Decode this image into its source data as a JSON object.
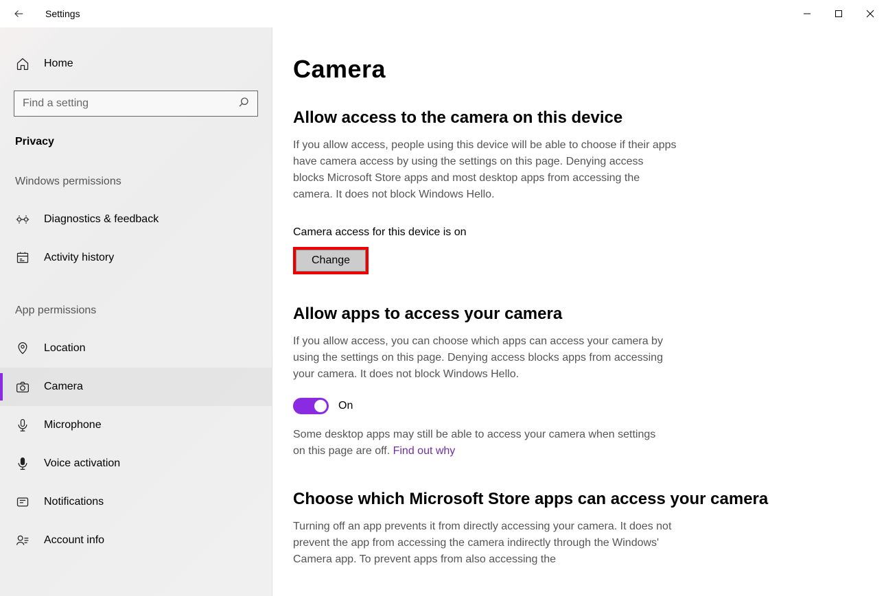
{
  "window": {
    "app_title": "Settings"
  },
  "sidebar": {
    "home_label": "Home",
    "search_placeholder": "Find a setting",
    "category_label": "Privacy",
    "groups": [
      {
        "label": "Windows permissions",
        "items": [
          {
            "id": "diagnostics",
            "label": "Diagnostics & feedback",
            "icon": "diagnostics-icon",
            "selected": false
          },
          {
            "id": "activity",
            "label": "Activity history",
            "icon": "history-icon",
            "selected": false
          }
        ]
      },
      {
        "label": "App permissions",
        "items": [
          {
            "id": "location",
            "label": "Location",
            "icon": "location-icon",
            "selected": false
          },
          {
            "id": "camera",
            "label": "Camera",
            "icon": "camera-icon",
            "selected": true
          },
          {
            "id": "microphone",
            "label": "Microphone",
            "icon": "microphone-icon",
            "selected": false
          },
          {
            "id": "voice",
            "label": "Voice activation",
            "icon": "voice-icon",
            "selected": false
          },
          {
            "id": "notifications",
            "label": "Notifications",
            "icon": "notifications-icon",
            "selected": false
          },
          {
            "id": "account",
            "label": "Account info",
            "icon": "account-icon",
            "selected": false
          }
        ]
      }
    ]
  },
  "main": {
    "page_title": "Camera",
    "section1": {
      "header": "Allow access to the camera on this device",
      "text": "If you allow access, people using this device will be able to choose if their apps have camera access by using the settings on this page. Denying access blocks Microsoft Store apps and most desktop apps from accessing the camera. It does not block Windows Hello.",
      "status": "Camera access for this device is on",
      "change_label": "Change"
    },
    "section2": {
      "header": "Allow apps to access your camera",
      "text": "If you allow access, you can choose which apps can access your camera by using the settings on this page. Denying access blocks apps from accessing your camera. It does not block Windows Hello.",
      "toggle_state": "On",
      "desktop_note": "Some desktop apps may still be able to access your camera when settings on this page are off. ",
      "link_label": "Find out why"
    },
    "section3": {
      "header": "Choose which Microsoft Store apps can access your camera",
      "text": "Turning off an app prevents it from directly accessing your camera. It does not prevent the app from accessing the camera indirectly through the Windows' Camera app. To prevent apps from also accessing the"
    }
  }
}
